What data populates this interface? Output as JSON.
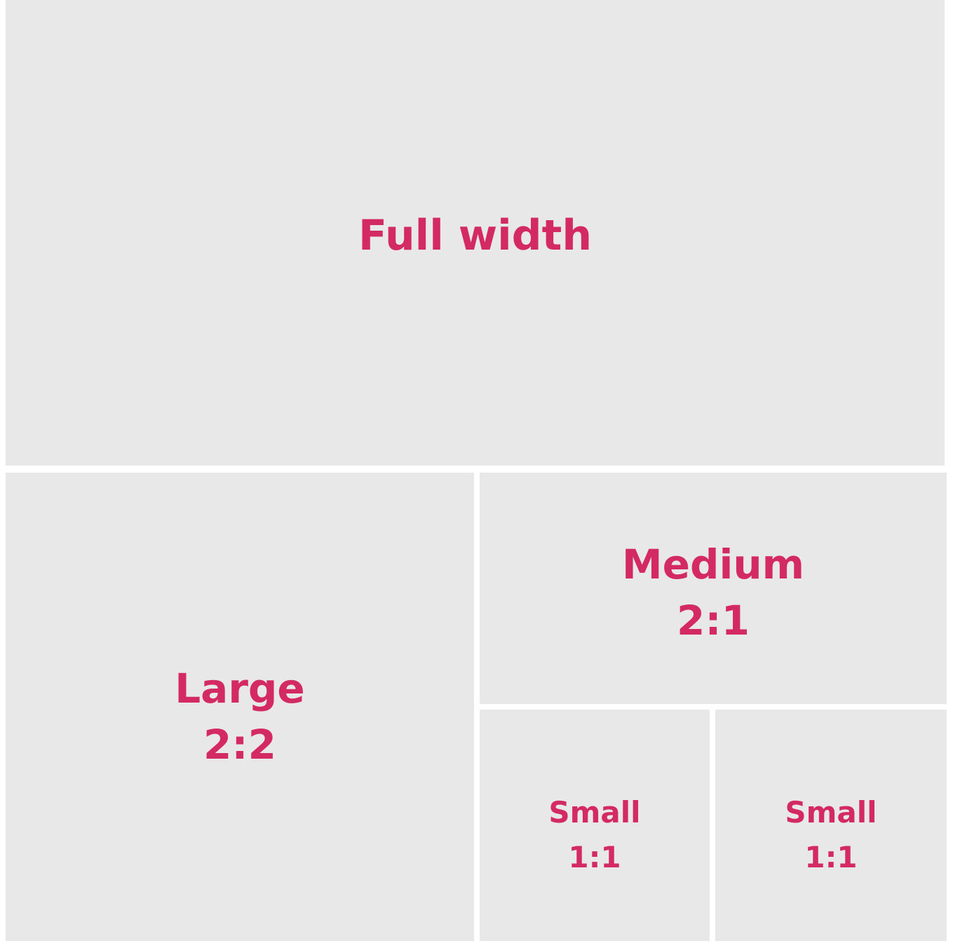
{
  "colors": {
    "tile_background": "#e9e8e8",
    "label_text": "#d42a63",
    "gutter": "#ffffff"
  },
  "tiles": {
    "full": {
      "line1": "Full width"
    },
    "large": {
      "line1": "Large",
      "line2": "2:2"
    },
    "medium": {
      "line1": "Medium",
      "line2": "2:1"
    },
    "small_1": {
      "line1": "Small",
      "line2": "1:1"
    },
    "small_2": {
      "line1": "Small",
      "line2": "1:1"
    }
  }
}
